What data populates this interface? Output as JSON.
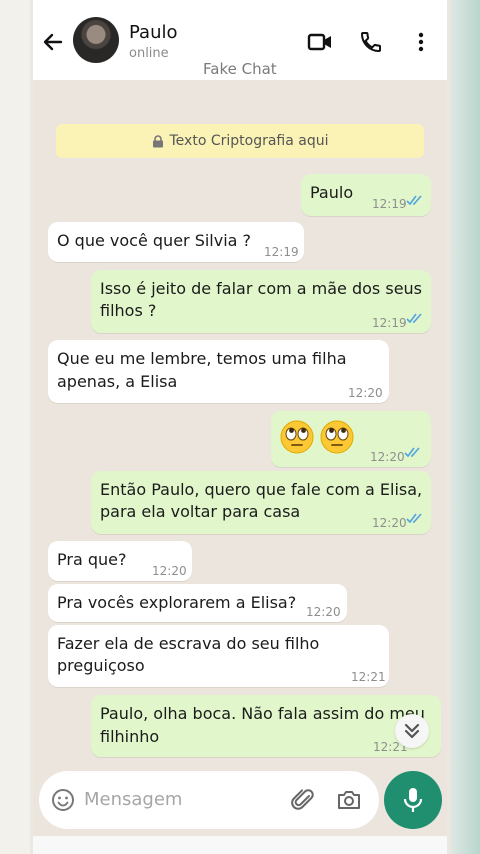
{
  "header": {
    "contact_name": "Paulo",
    "contact_status": "online",
    "caption": "Fake Chat",
    "icons": [
      "back-arrow-icon",
      "video-call-icon",
      "phone-icon",
      "more-options-icon"
    ]
  },
  "encryption_notice": "Texto Criptografia aqui",
  "messages": [
    {
      "dir": "out",
      "lines": [
        "Paulo"
      ],
      "time": "12:19",
      "read": true
    },
    {
      "dir": "in",
      "lines": [
        "O que você quer Silvia ?"
      ],
      "time": "12:19"
    },
    {
      "dir": "out",
      "lines": [
        "Isso é jeito de falar com a mãe dos seus",
        "filhos ?"
      ],
      "time": "12:19",
      "read": true
    },
    {
      "dir": "in",
      "lines": [
        "Que eu me lembre, temos uma filha",
        "apenas, a Elisa"
      ],
      "time": "12:20"
    },
    {
      "dir": "out",
      "emoji": [
        "face-with-rolling-eyes",
        "face-with-rolling-eyes"
      ],
      "time": "12:20",
      "read": true
    },
    {
      "dir": "out",
      "lines": [
        "Então Paulo, quero que fale com a Elisa,",
        "para ela voltar para casa"
      ],
      "time": "12:20",
      "read": true
    },
    {
      "dir": "in",
      "lines": [
        "Pra que?"
      ],
      "time": "12:20"
    },
    {
      "dir": "in",
      "lines": [
        "Pra vocês explorarem a Elisa?"
      ],
      "time": "12:20"
    },
    {
      "dir": "in",
      "lines": [
        "Fazer ela de escrava do seu filho",
        "preguiçoso"
      ],
      "time": "12:21"
    },
    {
      "dir": "out",
      "lines": [
        "Paulo, olha boca. Não fala assim do meu",
        "filhinho"
      ],
      "time": "12:21",
      "read": true
    }
  ],
  "composer": {
    "placeholder": "Mensagem",
    "icons": [
      "emoji-icon",
      "attach-icon",
      "camera-icon",
      "mic-icon"
    ]
  },
  "colors": {
    "incoming_bubble": "#ffffff",
    "outgoing_bubble": "#e1f7cb",
    "encryption_banner": "#fbf3b6",
    "mic_button": "#1f8f6f",
    "read_ticks": "#4fa3e0"
  }
}
